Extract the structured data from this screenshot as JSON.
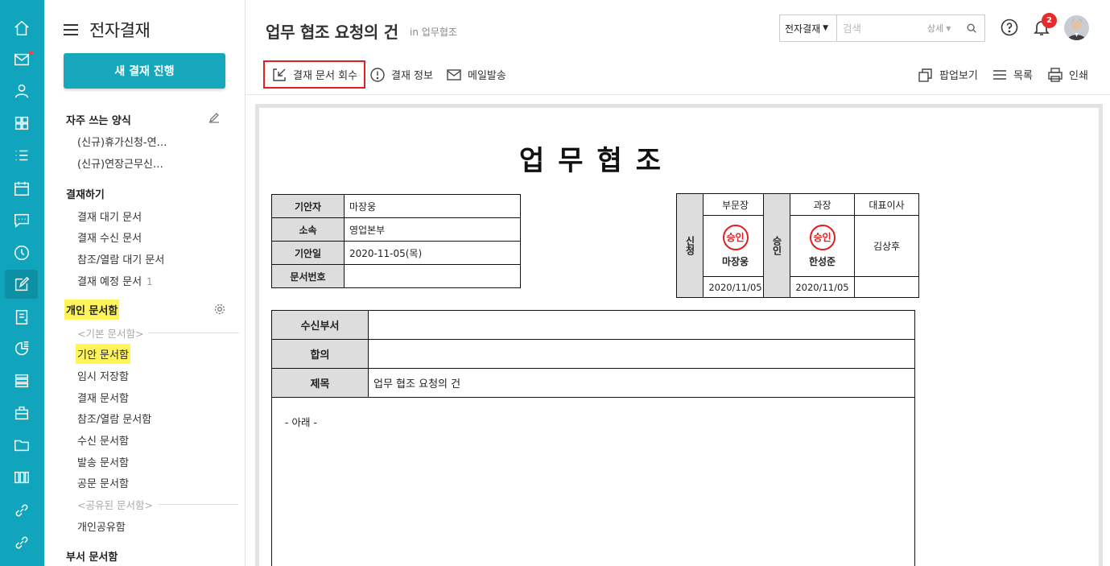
{
  "app": {
    "rail": [
      {
        "icon": "home-icon"
      },
      {
        "icon": "mail-icon",
        "has_dot": true
      },
      {
        "icon": "contacts-icon"
      },
      {
        "icon": "apps-icon"
      },
      {
        "icon": "list-icon"
      },
      {
        "icon": "calendar-icon"
      },
      {
        "icon": "chat-icon"
      },
      {
        "icon": "clock-icon"
      },
      {
        "icon": "approval-icon",
        "active": true
      },
      {
        "icon": "board-icon"
      },
      {
        "icon": "report-icon"
      },
      {
        "icon": "stack-icon"
      },
      {
        "icon": "briefcase-icon"
      },
      {
        "icon": "folder-icon"
      },
      {
        "icon": "library-icon"
      },
      {
        "icon": "link-icon"
      },
      {
        "icon": "link2-icon"
      }
    ]
  },
  "sidebar": {
    "title": "전자결재",
    "new_button": "새 결재 진행",
    "favorites_title": "자주 쓰는 양식",
    "favorites": [
      "(신규)휴가신청-연…",
      "(신규)연장근무신…"
    ],
    "approve_title": "결재하기",
    "approve_items": [
      "결재 대기 문서",
      "결재 수신 문서",
      "참조/열람 대기 문서",
      "결재 예정 문서"
    ],
    "approve_count": "1",
    "personal_title": "개인 문서함",
    "basic_label": "<기본 문서함>",
    "personal_items": [
      "기안 문서함",
      "임시 저장함",
      "결재 문서함",
      "참조/열람 문서함",
      "수신 문서함",
      "발송 문서함",
      "공문 문서함"
    ],
    "shared_label": "<공유된 문서함>",
    "shared_items": [
      "개인공유함"
    ],
    "dept_title": "부서 문서함"
  },
  "header": {
    "title": "업무 협조 요청의 건",
    "subtitle": "in 업무협조",
    "search_scope": "전자결재",
    "search_placeholder": "검색",
    "search_detail": "상세",
    "notification_count": "2"
  },
  "toolbar": {
    "recall": "결재 문서 회수",
    "info": "결재 정보",
    "mail": "메일발송",
    "popup": "팝업보기",
    "list": "목록",
    "print": "인쇄"
  },
  "document": {
    "title": "업무협조",
    "info": [
      {
        "key": "기안자",
        "value": "마장웅"
      },
      {
        "key": "소속",
        "value": "영업본부"
      },
      {
        "key": "기안일",
        "value": "2020-11-05(목)"
      },
      {
        "key": "문서번호",
        "value": ""
      }
    ],
    "apply": {
      "side": "신청",
      "role": "부문장",
      "stamp": "승인",
      "name": "마장웅",
      "date": "2020/11/05"
    },
    "approve": {
      "side": "승인",
      "roles": [
        "과장",
        "대표이사"
      ],
      "stamp": "승인",
      "names": [
        "한성준",
        "김상후"
      ],
      "dates": [
        "2020/11/05",
        ""
      ]
    },
    "body": [
      {
        "key": "수신부서",
        "value": ""
      },
      {
        "key": "합의",
        "value": ""
      },
      {
        "key": "제목",
        "value": "업무 협조 요청의 건"
      }
    ],
    "content": "- 아래 -"
  }
}
